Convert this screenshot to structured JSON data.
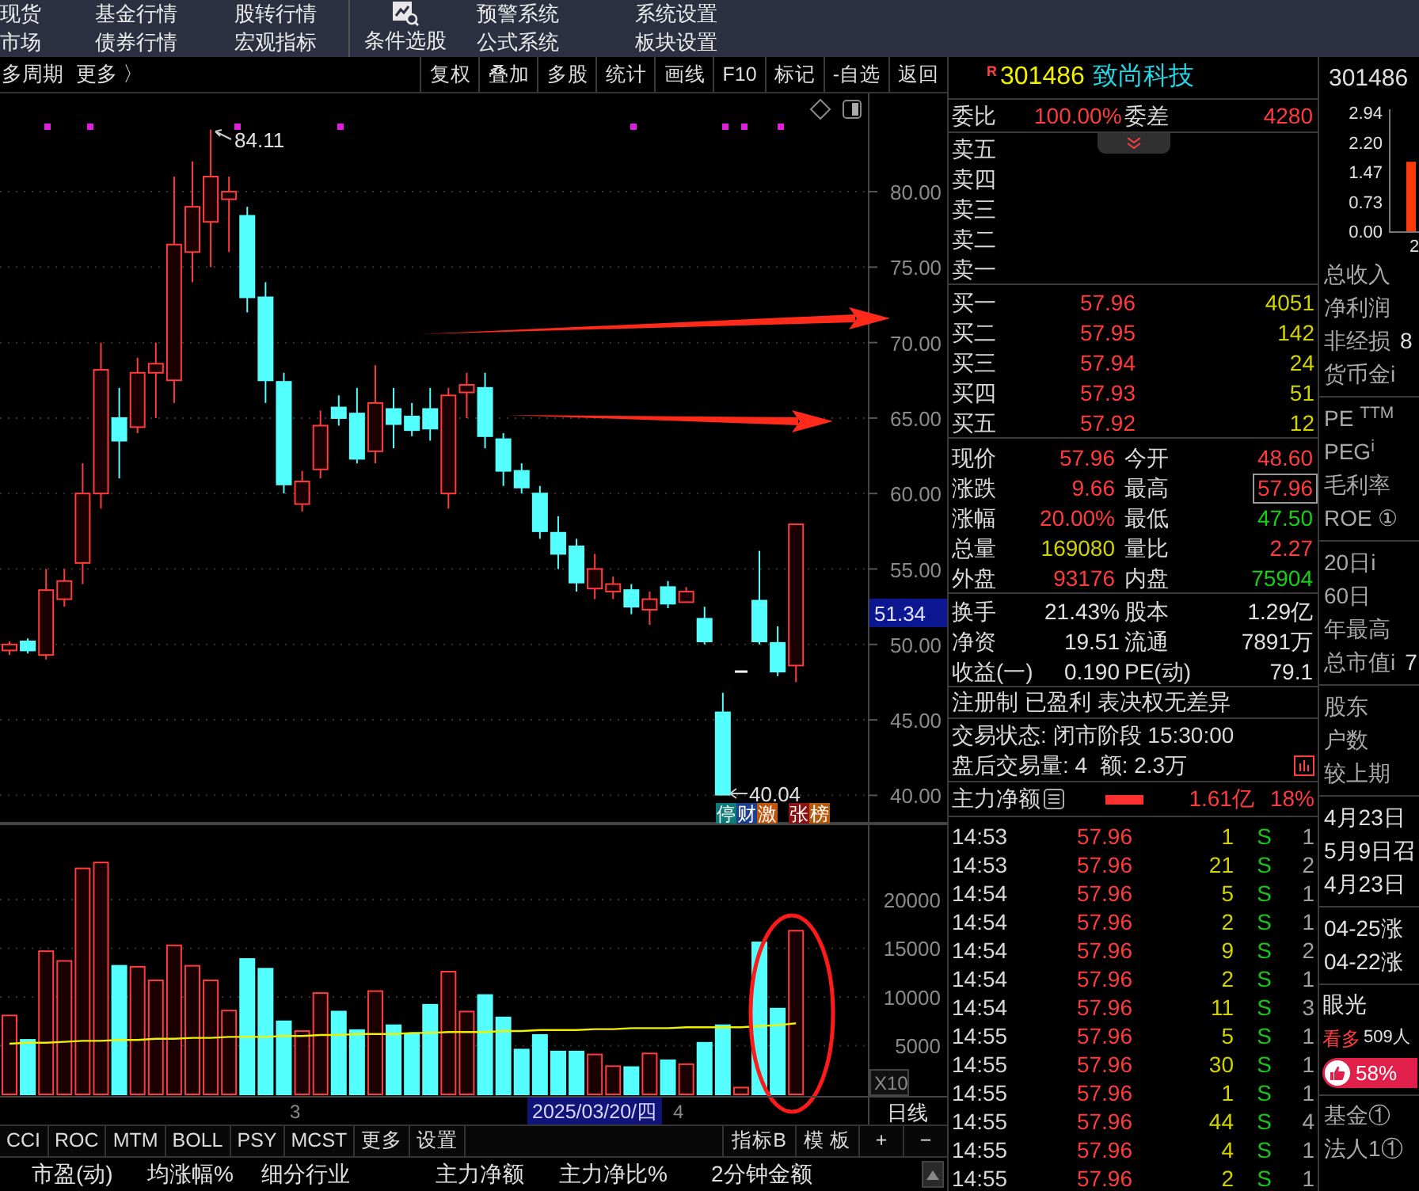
{
  "menu": {
    "left": [
      [
        "现货",
        "市场"
      ],
      [
        "基金行情",
        "债券行情"
      ],
      [
        "股转行情",
        "宏观指标"
      ]
    ],
    "stock_picker": "条件选股",
    "right": [
      [
        "预警系统",
        "公式系统"
      ],
      [
        "系统设置",
        "板块设置"
      ]
    ]
  },
  "toolbar": {
    "period": "多周期",
    "more": "更多 〉",
    "buttons": [
      "复权",
      "叠加",
      "多股",
      "统计",
      "画线",
      "F10",
      "标记",
      "-自选",
      "返回"
    ]
  },
  "price_chart": {
    "high": "84.11",
    "low": "40.04",
    "cursor_price": "51.34",
    "tags": [
      {
        "text": "停",
        "color": "#0d7c78"
      },
      {
        "text": "财",
        "color": "#1d3f8f"
      },
      {
        "text": "激",
        "color": "#c0560e"
      },
      {
        "text": "张",
        "color": "#8a1212"
      },
      {
        "text": "榜",
        "color": "#b45a0c"
      }
    ],
    "chart_data": {
      "type": "candlestick",
      "grid": true,
      "categories": [
        null,
        null,
        null,
        null,
        null,
        null,
        null,
        null,
        null,
        null,
        null,
        null,
        null,
        null,
        null,
        null,
        null,
        null,
        null,
        null,
        null,
        null,
        null,
        null,
        null,
        null,
        null,
        null,
        null,
        null,
        null,
        null,
        null,
        null,
        null,
        null,
        null,
        null,
        null,
        null,
        null,
        null,
        null,
        null
      ],
      "ylim": [
        38.13,
        86.51
      ],
      "yticks": [
        {
          "value": 80,
          "label": "80.00"
        },
        {
          "value": 75,
          "label": "75.00"
        },
        {
          "value": 70,
          "label": "70.00"
        },
        {
          "value": 65,
          "label": "65.00"
        },
        {
          "value": 60,
          "label": "60.00"
        },
        {
          "value": 55,
          "label": "55.00"
        },
        {
          "value": 50,
          "label": "50.00"
        },
        {
          "value": 45,
          "label": "45.00"
        },
        {
          "value": 40,
          "label": "40.00"
        }
      ],
      "ohlc": [
        [
          49.6,
          50.2,
          49.3,
          50.0
        ],
        [
          50.2,
          50.4,
          49.4,
          49.6
        ],
        [
          49.3,
          55,
          49,
          53.6
        ],
        [
          53,
          55,
          52.5,
          54.2
        ],
        [
          55.4,
          62,
          54,
          60
        ],
        [
          60,
          70,
          59,
          68.2
        ],
        [
          65,
          67,
          61,
          63.5
        ],
        [
          64.4,
          69,
          64,
          68
        ],
        [
          68,
          70,
          65,
          68.6
        ],
        [
          67.5,
          81,
          66,
          76.5
        ],
        [
          76,
          82,
          74,
          79
        ],
        [
          78,
          84.11,
          75,
          81
        ],
        [
          79.5,
          81,
          76,
          80
        ],
        [
          78.4,
          79,
          72,
          73
        ],
        [
          73,
          74,
          66,
          67.5
        ],
        [
          67.4,
          68,
          60,
          60.6
        ],
        [
          59.3,
          61.5,
          58.8,
          60.8
        ],
        [
          61.6,
          65.5,
          61,
          64.5
        ],
        [
          65.7,
          66.5,
          64.5,
          65
        ],
        [
          65.3,
          67,
          62,
          62.3
        ],
        [
          62.8,
          68.5,
          62,
          66
        ],
        [
          65.6,
          67,
          63,
          64.6
        ],
        [
          65.1,
          66,
          63.8,
          64.2
        ],
        [
          65.6,
          67,
          63.5,
          64.3
        ],
        [
          60,
          67,
          59,
          66.5
        ],
        [
          66.7,
          68,
          65,
          67.2
        ],
        [
          67,
          68,
          63,
          63.8
        ],
        [
          63.6,
          64,
          60.5,
          61.5
        ],
        [
          61.5,
          62,
          60,
          60.4
        ],
        [
          60,
          60.5,
          57,
          57.5
        ],
        [
          57.4,
          58.5,
          55,
          56
        ],
        [
          56.5,
          57,
          53.5,
          54.1
        ],
        [
          53.7,
          56,
          53,
          55
        ],
        [
          53.5,
          54.5,
          53,
          54
        ],
        [
          53.6,
          54,
          52,
          52.5
        ],
        [
          52.3,
          53.5,
          51.3,
          53
        ],
        [
          53.8,
          54.2,
          52.4,
          52.7
        ],
        [
          52.8,
          53.8,
          52.8,
          53.5
        ],
        [
          51.7,
          52.5,
          50,
          50.2
        ],
        [
          45.5,
          46.8,
          40.04,
          40.04
        ],
        [
          48.2,
          48.2,
          48.2,
          48.2
        ],
        [
          52.9,
          56.2,
          50,
          50.2
        ],
        [
          50.1,
          51.2,
          47.9,
          48.2
        ],
        [
          48.6,
          57.96,
          47.5,
          57.96
        ]
      ]
    }
  },
  "volume_chart": {
    "scale": "X10",
    "chart_data": {
      "type": "bar",
      "grid": true,
      "categories": [
        null,
        null,
        null,
        null,
        null,
        null,
        null,
        null,
        null,
        null,
        null,
        null,
        null,
        null,
        null,
        null,
        null,
        null,
        null,
        null,
        null,
        null,
        null,
        null,
        null,
        null,
        null,
        null,
        null,
        null,
        null,
        null,
        null,
        null,
        null,
        null,
        null,
        null,
        null,
        null,
        null,
        null,
        null,
        null
      ],
      "ylim": [
        0,
        27800
      ],
      "yticks": [
        5000,
        10000,
        15000,
        20000
      ],
      "series": [
        {
          "type": "bar",
          "colors": [
            "#ff3b3b",
            "#54ffff",
            "#ff3b3b",
            "#ff3b3b",
            "#ff3b3b",
            "#ff3b3b",
            "#54ffff",
            "#ff3b3b",
            "#ff3b3b",
            "#ff3b3b",
            "#ff3b3b",
            "#ff3b3b",
            "#ff3b3b",
            "#54ffff",
            "#54ffff",
            "#54ffff",
            "#ff3b3b",
            "#ff3b3b",
            "#54ffff",
            "#54ffff",
            "#ff3b3b",
            "#54ffff",
            "#54ffff",
            "#54ffff",
            "#ff3b3b",
            "#ff3b3b",
            "#54ffff",
            "#54ffff",
            "#54ffff",
            "#54ffff",
            "#54ffff",
            "#54ffff",
            "#ff3b3b",
            "#ff3b3b",
            "#54ffff",
            "#ff3b3b",
            "#54ffff",
            "#ff3b3b",
            "#54ffff",
            "#54ffff",
            "#ff3b3b",
            "#54ffff",
            "#54ffff",
            "#ff3b3b"
          ],
          "values": [
            8100,
            5600,
            14700,
            13700,
            23200,
            23800,
            13200,
            13100,
            11700,
            15300,
            13200,
            11700,
            8600,
            13900,
            12900,
            7500,
            6500,
            10400,
            8500,
            6600,
            10600,
            7100,
            6200,
            9200,
            12600,
            8500,
            10200,
            7900,
            4600,
            6100,
            4400,
            4400,
            4100,
            2900,
            2800,
            4200,
            3500,
            3100,
            5300,
            7100,
            700,
            15600,
            8800,
            16800
          ]
        },
        {
          "type": "line",
          "color": "#f0f000",
          "values": [
            5200,
            5300,
            5300,
            5400,
            5500,
            5500,
            5600,
            5600,
            5700,
            5700,
            5800,
            5800,
            5900,
            5900,
            5900,
            6000,
            6000,
            6100,
            6100,
            6200,
            6200,
            6200,
            6300,
            6300,
            6400,
            6400,
            6400,
            6500,
            6500,
            6600,
            6600,
            6600,
            6700,
            6700,
            6800,
            6800,
            6800,
            6900,
            6900,
            6900,
            6900,
            7000,
            7100,
            7300
          ]
        }
      ]
    }
  },
  "x_axis": {
    "labels": [
      "3",
      "4"
    ],
    "cursor_date": "2025/03/20/四",
    "period": "日线"
  },
  "indicator_tabs": [
    "CCI",
    "ROC",
    "MTM",
    "BOLL",
    "PSY",
    "MCST",
    "更多",
    "设置"
  ],
  "indicator_right": [
    "指标B",
    "模 板",
    "+",
    "−"
  ],
  "list_columns": [
    "市盈(动)",
    "均涨幅%",
    "细分行业",
    "主力净额",
    "主力净比%",
    "2分钟金额"
  ],
  "quote": {
    "badge": "R",
    "code": "301486",
    "name": "致尚科技",
    "ratio": {
      "label": "委比",
      "value": "100.00%",
      "label2": "委差",
      "value2": "4280"
    },
    "asks": [
      "卖五",
      "卖四",
      "卖三",
      "卖二",
      "卖一"
    ],
    "bids": [
      {
        "label": "买一",
        "price": "57.96",
        "volume": "4051"
      },
      {
        "label": "买二",
        "price": "57.95",
        "volume": "142"
      },
      {
        "label": "买三",
        "price": "57.94",
        "volume": "24"
      },
      {
        "label": "买四",
        "price": "57.93",
        "volume": "51"
      },
      {
        "label": "买五",
        "price": "57.92",
        "volume": "12"
      }
    ],
    "stats": [
      [
        {
          "label": "现价",
          "value": "57.96",
          "color": "#ff3b3b",
          "boxed": false
        },
        {
          "label": "今开",
          "value": "48.60",
          "color": "#ff3b3b",
          "boxed": false
        }
      ],
      [
        {
          "label": "涨跌",
          "value": "9.66",
          "color": "#ff3b3b",
          "boxed": false
        },
        {
          "label": "最高",
          "value": "57.96",
          "color": "#ff3b3b",
          "boxed": true
        }
      ],
      [
        {
          "label": "涨幅",
          "value": "20.00%",
          "color": "#ff3b3b",
          "boxed": false
        },
        {
          "label": "最低",
          "value": "47.50",
          "color": "#16d016",
          "boxed": false
        }
      ],
      [
        {
          "label": "总量",
          "value": "169080",
          "color": "#d2d200",
          "boxed": false
        },
        {
          "label": "量比",
          "value": "2.27",
          "color": "#ff3b3b",
          "boxed": false
        }
      ],
      [
        {
          "label": "外盘",
          "value": "93176",
          "color": "#ff3b3b",
          "boxed": false
        },
        {
          "label": "内盘",
          "value": "75904",
          "color": "#16d016",
          "boxed": false
        }
      ]
    ],
    "info": [
      {
        "label": "换手",
        "value": "21.43%",
        "label2": "股本",
        "value2": "1.29亿"
      },
      {
        "label": "净资",
        "value": "19.51",
        "label2": "流通",
        "value2": "7891万"
      },
      {
        "label": "收益(一)",
        "value": "0.190",
        "label2": "PE(动)",
        "value2": "79.1"
      }
    ],
    "notice": "注册制 已盈利 表决权无差异",
    "status": "交易状态: 闭市阶段 15:30:00",
    "after_hours": "盘后交易量: 4  额: 2.3万",
    "main_flow": {
      "label": "主力净额",
      "value": "1.61亿",
      "pct": "18%"
    },
    "trades": [
      {
        "time": "14:53",
        "price": "57.96",
        "volume": "1",
        "side": "S",
        "count": "1"
      },
      {
        "time": "14:53",
        "price": "57.96",
        "volume": "21",
        "side": "S",
        "count": "2"
      },
      {
        "time": "14:54",
        "price": "57.96",
        "volume": "5",
        "side": "S",
        "count": "1"
      },
      {
        "time": "14:54",
        "price": "57.96",
        "volume": "2",
        "side": "S",
        "count": "1"
      },
      {
        "time": "14:54",
        "price": "57.96",
        "volume": "9",
        "side": "S",
        "count": "2"
      },
      {
        "time": "14:54",
        "price": "57.96",
        "volume": "2",
        "side": "S",
        "count": "1"
      },
      {
        "time": "14:54",
        "price": "57.96",
        "volume": "11",
        "side": "S",
        "count": "3"
      },
      {
        "time": "14:55",
        "price": "57.96",
        "volume": "5",
        "side": "S",
        "count": "1"
      },
      {
        "time": "14:55",
        "price": "57.96",
        "volume": "30",
        "side": "S",
        "count": "1"
      },
      {
        "time": "14:55",
        "price": "57.96",
        "volume": "1",
        "side": "S",
        "count": "1"
      },
      {
        "time": "14:55",
        "price": "57.96",
        "volume": "44",
        "side": "S",
        "count": "4"
      },
      {
        "time": "14:55",
        "price": "57.96",
        "volume": "4",
        "side": "S",
        "count": "1"
      },
      {
        "time": "14:55",
        "price": "57.96",
        "volume": "2",
        "side": "S",
        "count": "1"
      }
    ]
  },
  "side": {
    "code": "301486",
    "chart_data": {
      "type": "bar",
      "categories": [
        "2"
      ],
      "values": [
        1.72
      ],
      "ylim": [
        0,
        3.02
      ],
      "yticks": [
        {
          "value": 0,
          "label": "0.00"
        },
        {
          "value": 0.73,
          "label": "0.73"
        },
        {
          "value": 1.47,
          "label": "1.47"
        },
        {
          "value": 2.2,
          "label": "2.20"
        },
        {
          "value": 2.94,
          "label": "2.94"
        }
      ]
    },
    "groups": [
      [
        {
          "label": "总收入"
        },
        {
          "label": "净利润"
        },
        {
          "label": "非经损",
          "value": "8"
        },
        {
          "label": "货币金i"
        }
      ],
      [
        {
          "label": "PE $^{TTM}$"
        },
        {
          "label": "PEG$^{i}$"
        },
        {
          "label": "毛利率"
        },
        {
          "label": "ROE ①"
        }
      ],
      [
        {
          "label": "20日i"
        },
        {
          "label": "60日"
        },
        {
          "label": "年最高"
        },
        {
          "label": "总市值i",
          "value": "7"
        }
      ],
      [
        {
          "label": "股东"
        },
        {
          "label": "户数"
        },
        {
          "label": "较上期"
        }
      ],
      [
        {
          "label": "4月23日"
        },
        {
          "label": "5月9日召"
        },
        {
          "label": "4月23日"
        }
      ],
      [
        {
          "label": "04-25涨"
        },
        {
          "label": "04-22涨"
        }
      ]
    ],
    "vision": {
      "title": "眼光",
      "bull": "看多",
      "count": "509人",
      "pct": "58%"
    },
    "holders": [
      "基金①",
      "法人1①"
    ]
  }
}
